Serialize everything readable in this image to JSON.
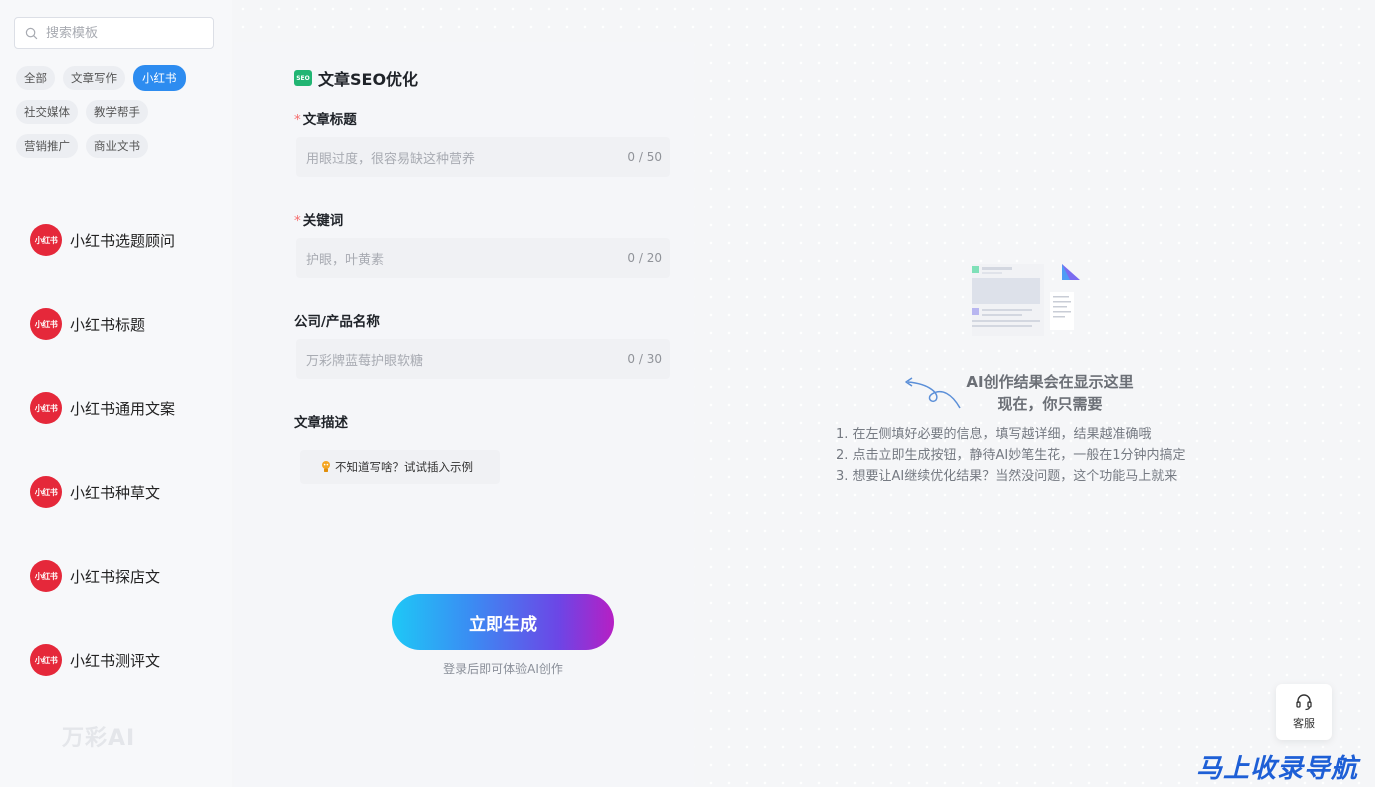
{
  "search": {
    "placeholder": "搜索模板"
  },
  "tags": {
    "row1": [
      "全部",
      "文章写作",
      "小红书"
    ],
    "row2": [
      "社交媒体",
      "教学帮手"
    ],
    "row3": [
      "营销推广",
      "商业文书"
    ],
    "active": "小红书"
  },
  "templates": {
    "logo_text": "小红书",
    "items": [
      "小红书选题顾问",
      "小红书标题",
      "小红书通用文案",
      "小红书种草文",
      "小红书探店文",
      "小红书测评文"
    ]
  },
  "brand": {
    "name": "万彩AI"
  },
  "form": {
    "icon_text": "SEO",
    "title": "文章SEO优化",
    "fields": [
      {
        "label": "文章标题",
        "required": "*",
        "placeholder": "用眼过度，很容易缺这种营养",
        "count": "0 / 50"
      },
      {
        "label": "关键词",
        "required": "*",
        "placeholder": "护眼，叶黄素",
        "count": "0 / 20"
      },
      {
        "label": "公司/产品名称",
        "placeholder": "万彩牌蓝莓护眼软糖",
        "count": "0 / 30"
      }
    ],
    "desc_label": "文章描述",
    "example_text": "不知道写啥？试试插入示例",
    "generate_button": "立即生成",
    "login_hint": "登录后即可体验AI创作"
  },
  "result": {
    "title_line1": "AI创作结果会在显示这里",
    "title_line2": "现在，你只需要",
    "steps": [
      "1. 在左侧填好必要的信息，填写越详细，结果越准确哦",
      "2. 点击立即生成按钮，静待AI妙笔生花，一般在1分钟内搞定",
      "3. 想要让AI继续优化结果？当然没问题，这个功能马上就来"
    ]
  },
  "service": {
    "label": "客服"
  },
  "watermark": "马上收录导航",
  "colors": {
    "accent": "#2d8cf0",
    "brand_red": "#e5283a",
    "seo_green": "#21b573"
  }
}
